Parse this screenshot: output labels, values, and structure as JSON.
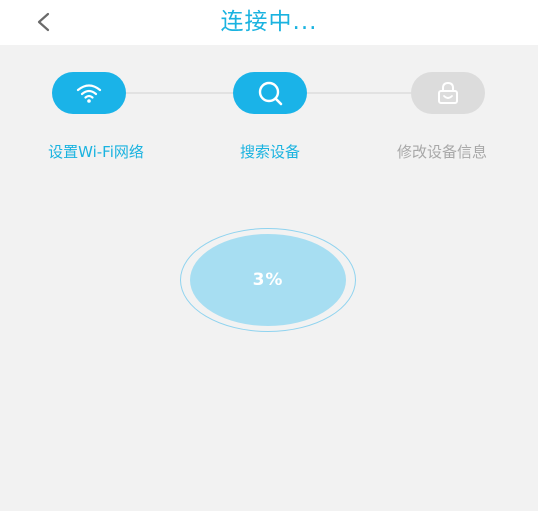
{
  "header": {
    "back_icon": "chevron-left-icon",
    "title": "连接中..."
  },
  "steps": [
    {
      "label": "设置Wi-Fi网络",
      "icon": "wifi-icon",
      "state": "active"
    },
    {
      "label": "搜索设备",
      "icon": "search-icon",
      "state": "active"
    },
    {
      "label": "修改设备信息",
      "icon": "lock-icon",
      "state": "inactive"
    }
  ],
  "progress": {
    "percent": 3,
    "text": "3%"
  },
  "colors": {
    "accent": "#1ab3e0",
    "inactive": "#a8a8a8",
    "progress_fill": "#a7def2",
    "background": "#f2f2f2"
  }
}
